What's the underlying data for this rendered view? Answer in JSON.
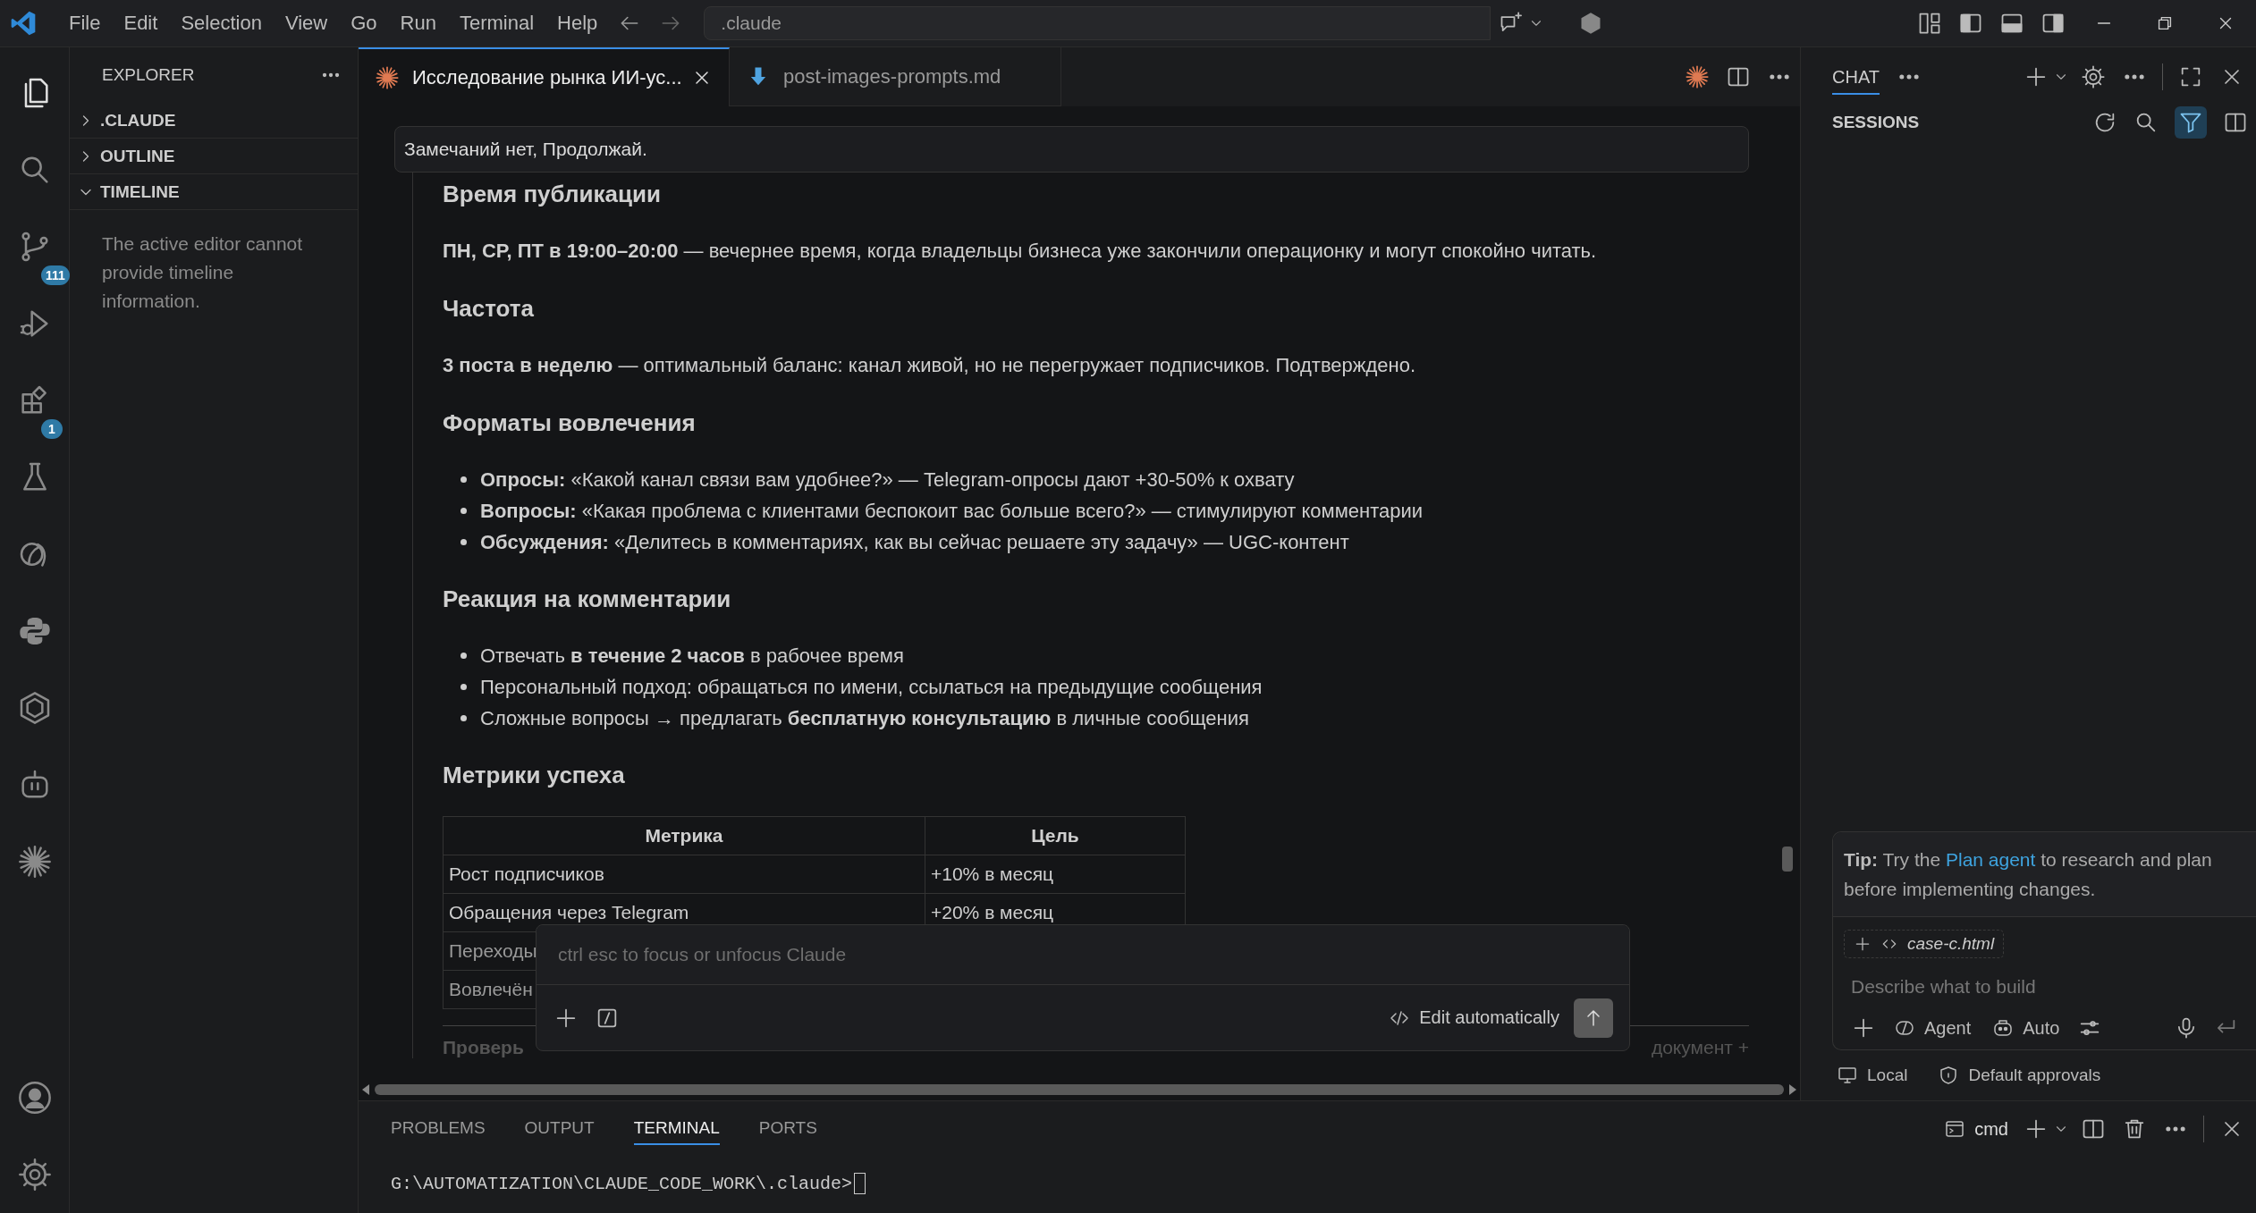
{
  "menu": [
    "File",
    "Edit",
    "Selection",
    "View",
    "Go",
    "Run",
    "Terminal",
    "Help"
  ],
  "command_center": {
    "value": ".claude"
  },
  "activity_bar": {
    "items": [
      {
        "kind": "files",
        "selected": true
      },
      {
        "kind": "search",
        "selected": false
      },
      {
        "kind": "branch",
        "selected": false,
        "badge": "111"
      },
      {
        "kind": "run",
        "selected": false
      },
      {
        "kind": "blocks",
        "selected": false,
        "badge": "1"
      },
      {
        "kind": "flask",
        "selected": false
      },
      {
        "kind": "bubbles",
        "selected": false
      },
      {
        "kind": "snakes",
        "selected": false
      },
      {
        "kind": "hexring",
        "selected": false
      },
      {
        "kind": "robot",
        "selected": false
      },
      {
        "kind": "asterisk",
        "selected": false
      }
    ],
    "bottom_items": [
      {
        "kind": "account"
      },
      {
        "kind": "gear"
      }
    ]
  },
  "sidebar": {
    "title": "EXPLORER",
    "sections": [
      {
        "label": ".CLAUDE",
        "expanded": false
      },
      {
        "label": "OUTLINE",
        "expanded": false
      },
      {
        "label": "TIMELINE",
        "expanded": true,
        "message": "The active editor cannot provide timeline information."
      }
    ]
  },
  "editor_tabs": [
    {
      "label": "Исследование рынка ИИ-ус...",
      "kind": "asterisk",
      "selected": true
    },
    {
      "label": "post-images-prompts.md",
      "kind": "download",
      "selected": false
    }
  ],
  "message_bar": "Замечаний нет, Продолжай.",
  "document": {
    "blocks": [
      {
        "kind": "heading",
        "text": "Время публикации"
      },
      {
        "kind": "paragraph",
        "text": "**ПН, СР, ПТ в 19:00–20:00** — вечернее время, когда владельцы бизнеса уже закончили операционку и могут спокойно читать."
      },
      {
        "kind": "heading",
        "text": "Частота"
      },
      {
        "kind": "paragraph",
        "text": "**3 поста в неделю** — оптимальный баланс: канал живой, но не перегружает подписчиков. Подтверждено."
      },
      {
        "kind": "heading",
        "text": "Форматы вовлечения"
      },
      {
        "kind": "list",
        "items": [
          "**Опросы:** «Какой канал связи вам удобнее?» — Telegram-опросы дают +30-50% к охвату",
          "**Вопросы:** «Какая проблема с клиентами беспокоит вас больше всего?» — стимулируют комментарии",
          "**Обсуждения:** «Делитесь в комментариях, как вы сейчас решаете эту задачу» — UGC-контент"
        ]
      },
      {
        "kind": "heading",
        "text": "Реакция на комментарии"
      },
      {
        "kind": "list",
        "items": [
          "Отвечать **в течение 2 часов** в рабочее время",
          "Персональный подход: обращаться по имени, ссылаться на предыдущие сообщения",
          "Сложные вопросы → предлагать **бесплатную консультацию** в личные сообщения"
        ]
      },
      {
        "kind": "heading",
        "text": "Метрики успеха"
      },
      {
        "kind": "table",
        "columns": [
          "Метрика",
          "Цель"
        ],
        "rows": [
          [
            "Рост подписчиков",
            "+10% в месяц"
          ],
          [
            "Обращения через Telegram",
            "+20% в месяц"
          ],
          [
            "Переходы"
          ],
          [
            "Вовлечён"
          ]
        ]
      },
      {
        "kind": "rule"
      },
      {
        "kind": "cut_line",
        "left": "Проверь",
        "right": "документ +"
      }
    ]
  },
  "claude_input": {
    "placeholder": "ctrl esc to focus or unfocus Claude",
    "mode": "Edit automatically"
  },
  "chat": {
    "tab": "CHAT",
    "sessions_title": "SESSIONS",
    "filter_active": true,
    "tip": {
      "before": "**Tip:** Try the ",
      "link": "Plan agent",
      "after": " to research and plan before implementing changes."
    },
    "attachment": "case-c.html",
    "placeholder": "Describe what to build",
    "agent": "Agent",
    "model": "Auto",
    "footer": [
      "Local",
      "Default approvals"
    ]
  },
  "panel": {
    "tabs": [
      {
        "label": "PROBLEMS",
        "selected": false
      },
      {
        "label": "OUTPUT",
        "selected": false
      },
      {
        "label": "TERMINAL",
        "selected": true
      },
      {
        "label": "PORTS",
        "selected": false
      }
    ],
    "terminal_name": "cmd",
    "lines": [
      "G:\\AUTOMATIZATION\\CLAUDE_CODE_WORK\\.claude>"
    ]
  }
}
